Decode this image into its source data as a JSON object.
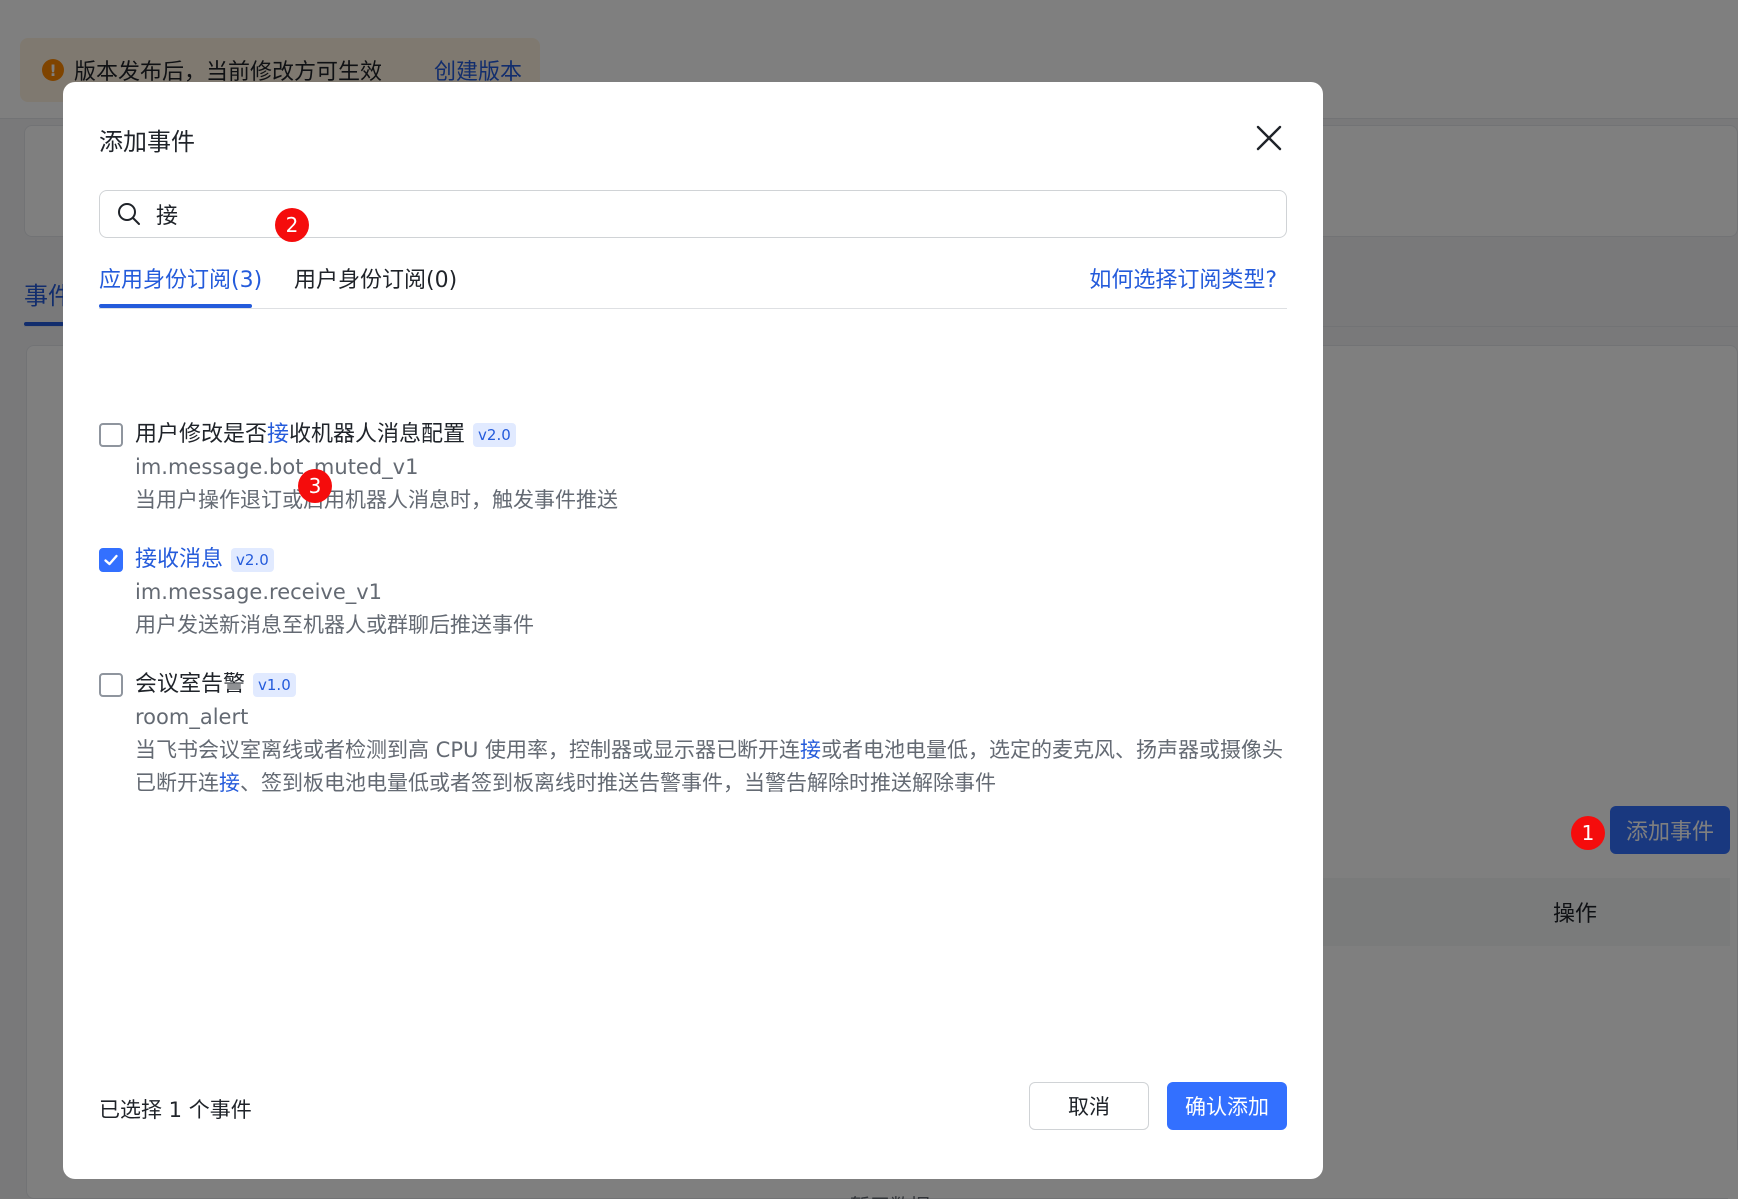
{
  "background": {
    "notice_text": "版本发布后，当前修改方可生效",
    "notice_link": "创建版本",
    "tab_partial": "事件",
    "add_event_button": "添加事件",
    "table_header_action": "操作",
    "bottom_text": "暂无数据"
  },
  "modal": {
    "title": "添加事件",
    "search": {
      "value": "接",
      "placeholder": ""
    },
    "tabs": [
      {
        "label": "应用身份订阅(3)",
        "active": true
      },
      {
        "label": "用户身份订阅(0)",
        "active": false
      }
    ],
    "help_link": "如何选择订阅类型?",
    "events": [
      {
        "title_pre": "用户修改是否",
        "title_hl": "接",
        "title_post": "收机器人消息配置",
        "version": "v2.0",
        "code": "im.message.bot_muted_v1",
        "desc_pre": "当用户操作退订或启用机器人消息时，触发事件推送",
        "checked": false
      },
      {
        "title_pre": "",
        "title_hl": "",
        "title_post": "接收消息",
        "version": "v2.0",
        "code": "im.message.receive_v1",
        "desc_pre": "用户发送新消息至机器人或群聊后推送事件",
        "checked": true
      },
      {
        "title_pre": "会议室告警",
        "title_hl": "",
        "title_post": "",
        "version": "v1.0",
        "code": "room_alert",
        "desc_pre": "当飞书会议室离线或者检测到高 CPU 使用率，控制器或显示器已断开连",
        "desc_hl1": "接",
        "desc_mid": "或者电池电量低，选定的麦克风、扬声器或摄像头已断开连",
        "desc_hl2": "接",
        "desc_post": "、签到板电池电量低或者签到板离线时推送告警事件，当警告解除时推送解除事件",
        "checked": false
      }
    ],
    "selected_count": "已选择 1 个事件",
    "cancel_label": "取消",
    "confirm_label": "确认添加"
  },
  "markers": [
    "1",
    "2",
    "3"
  ],
  "colors": {
    "primary": "#3370ff",
    "link": "#245bdb",
    "marker": "#f50c0c"
  }
}
